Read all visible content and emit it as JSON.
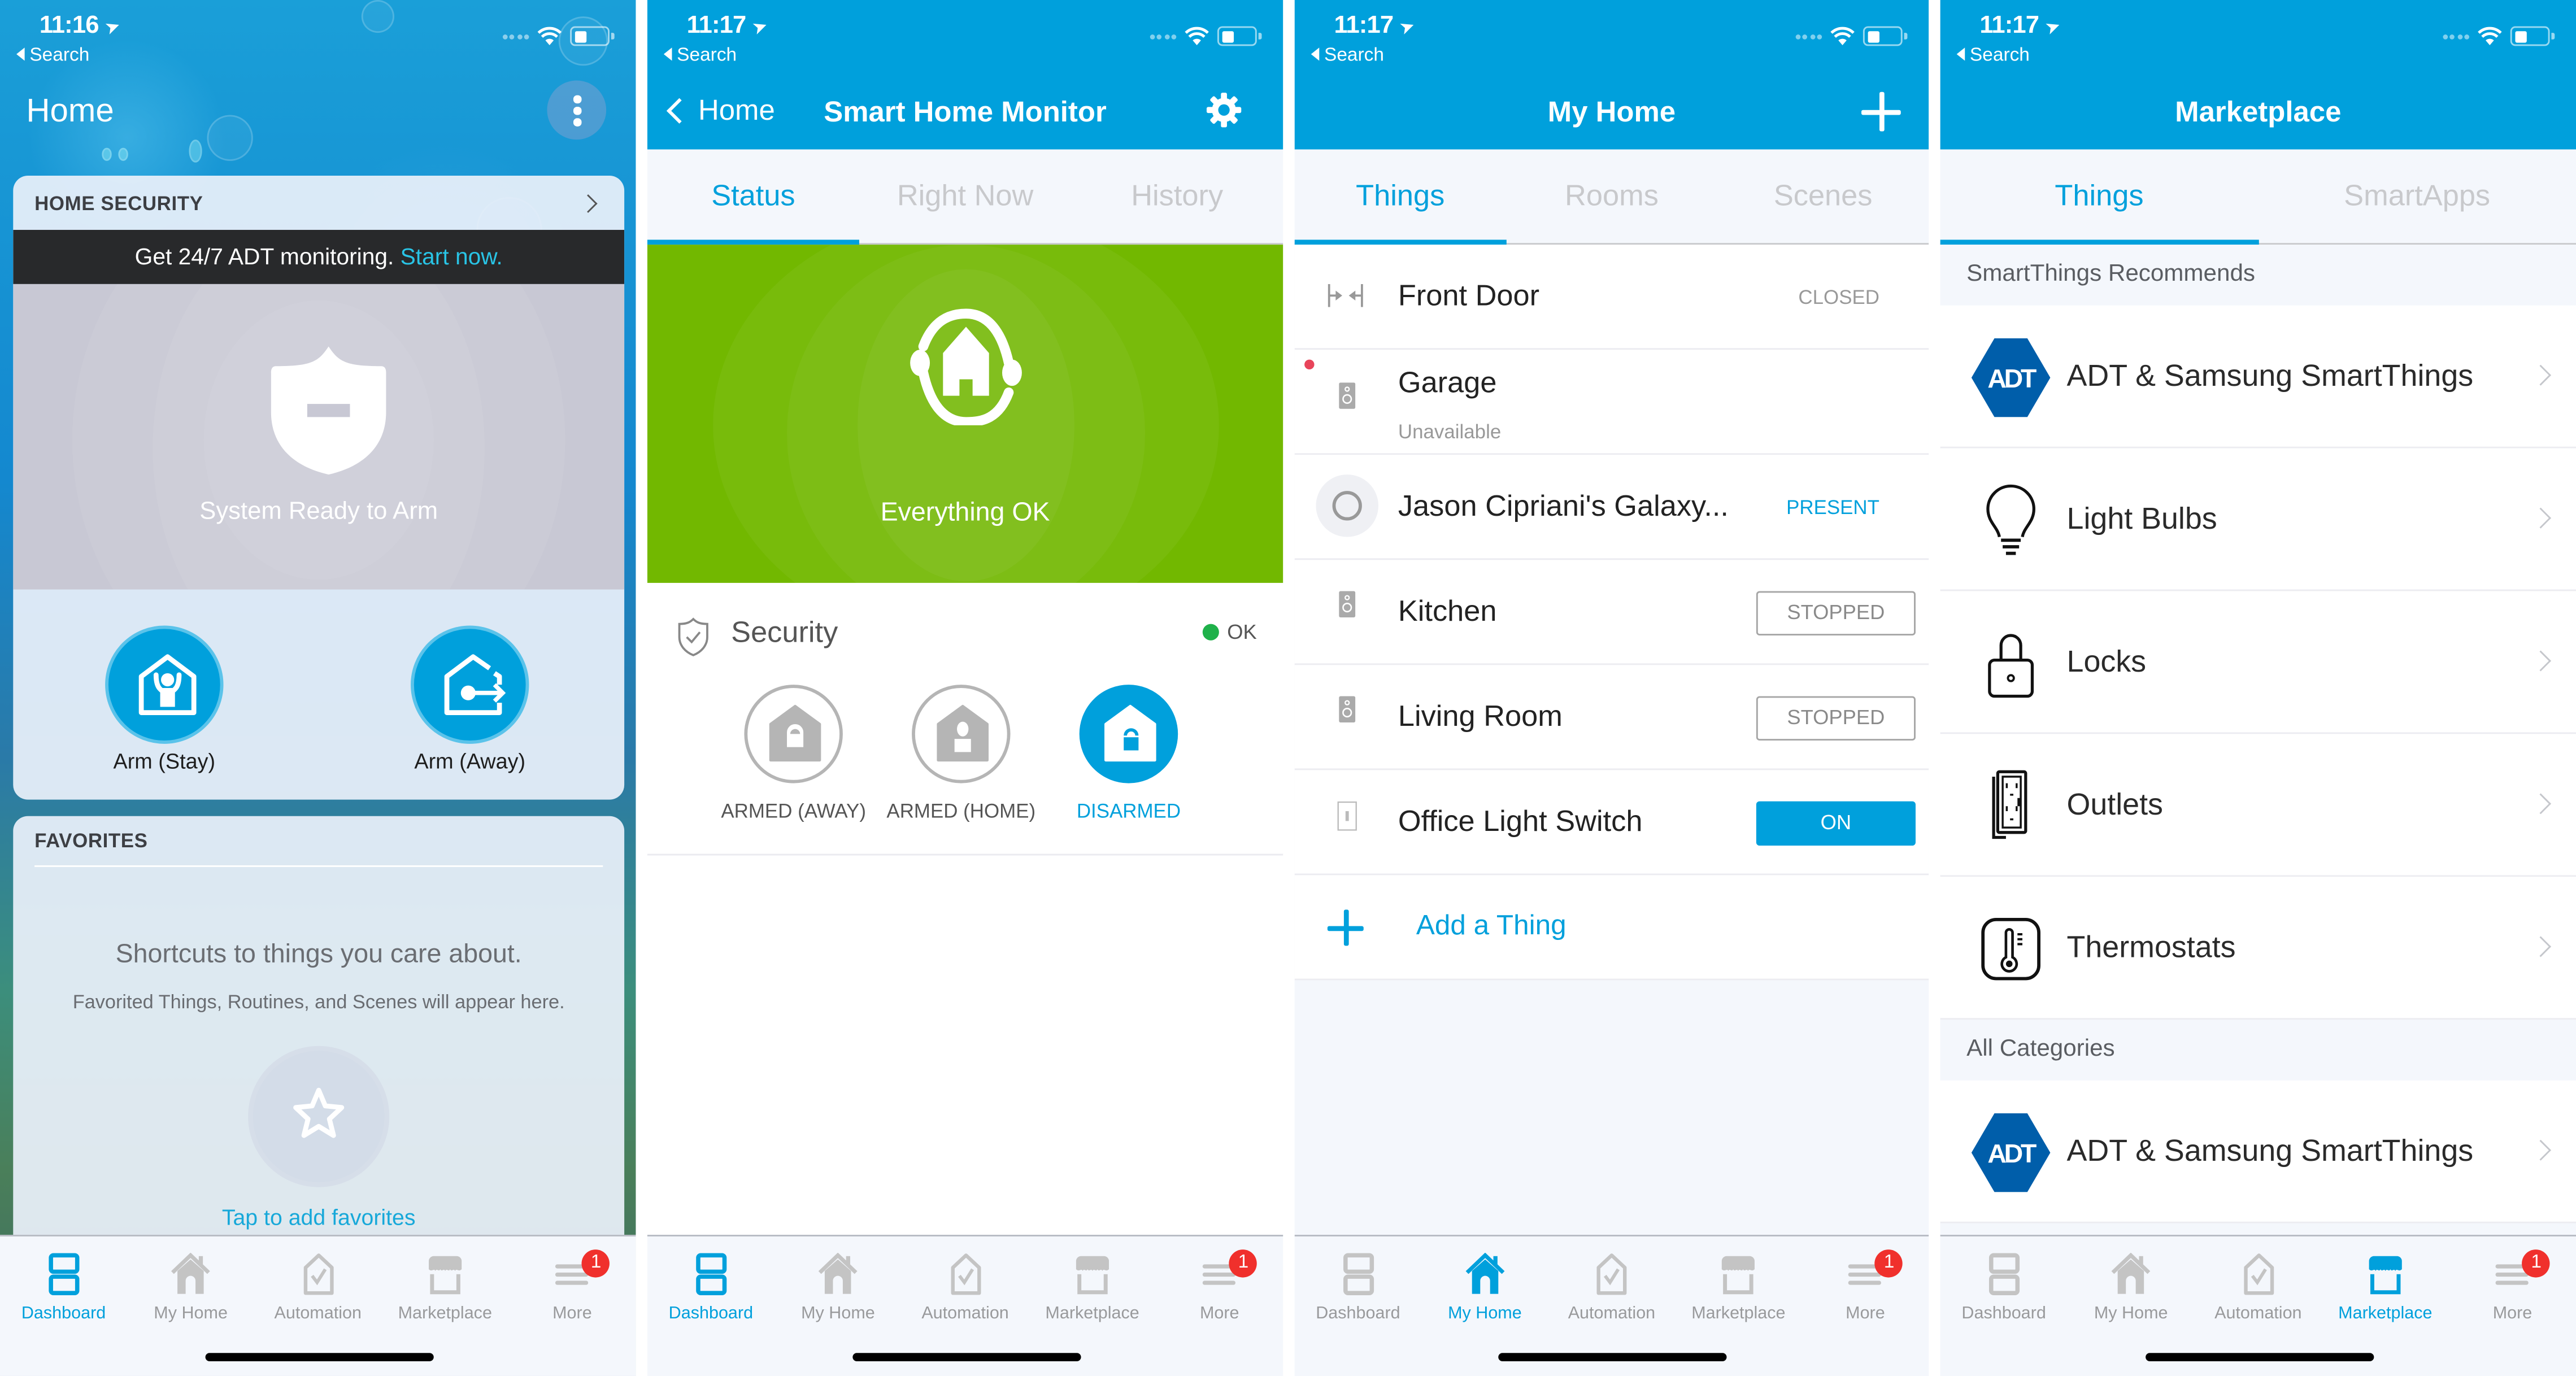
{
  "status_bars": [
    {
      "time": "11:16",
      "back_label": "Search"
    },
    {
      "time": "11:17",
      "back_label": "Search"
    },
    {
      "time": "11:17",
      "back_label": "Search"
    },
    {
      "time": "11:17",
      "back_label": "Search"
    }
  ],
  "tab_bar": {
    "items": [
      {
        "label": "Dashboard",
        "icon": "dashboard-icon"
      },
      {
        "label": "My Home",
        "icon": "home-icon"
      },
      {
        "label": "Automation",
        "icon": "automation-icon"
      },
      {
        "label": "Marketplace",
        "icon": "marketplace-icon"
      },
      {
        "label": "More",
        "icon": "menu-icon",
        "badge": "1"
      }
    ],
    "active_per_screen": [
      "Dashboard",
      "Dashboard",
      "My Home",
      "Marketplace"
    ],
    "active_color": "#00a0dc",
    "inactive_color": "#999a9c",
    "badge_color": "#f0302c"
  },
  "dashboard": {
    "title": "Home",
    "home_security": {
      "header": "HOME SECURITY",
      "banner_text": "Get 24/7 ADT monitoring.",
      "banner_link": "Start now.",
      "status_text": "System Ready to Arm",
      "buttons": [
        {
          "label": "Arm (Stay)",
          "icon": "arm-stay-icon"
        },
        {
          "label": "Arm (Away)",
          "icon": "arm-away-icon"
        }
      ]
    },
    "favorites": {
      "header": "FAVORITES",
      "headline": "Shortcuts to things you care about.",
      "subtext": "Favorited Things, Routines, and Scenes will appear here.",
      "link": "Tap to add favorites"
    }
  },
  "smart_home_monitor": {
    "back_label": "Home",
    "title": "Smart Home Monitor",
    "tabs": [
      {
        "label": "Status",
        "active": true
      },
      {
        "label": "Right Now",
        "active": false
      },
      {
        "label": "History",
        "active": false
      }
    ],
    "status_text": "Everything OK",
    "status_color": "#72b800",
    "security": {
      "title": "Security",
      "state_label": "OK",
      "state_color": "#1fb14a",
      "modes": [
        {
          "label": "ARMED (AWAY)",
          "active": false
        },
        {
          "label": "ARMED (HOME)",
          "active": false
        },
        {
          "label": "DISARMED",
          "active": true
        }
      ]
    }
  },
  "my_home": {
    "title": "My Home",
    "tabs": [
      {
        "label": "Things",
        "active": true
      },
      {
        "label": "Rooms",
        "active": false
      },
      {
        "label": "Scenes",
        "active": false
      }
    ],
    "things": [
      {
        "name": "Front Door",
        "status": "CLOSED",
        "type": "text",
        "icon": "contact-sensor-icon"
      },
      {
        "name": "Garage",
        "sub": "Unavailable",
        "type": "none",
        "icon": "speaker-icon",
        "alert": true
      },
      {
        "name": "Jason Cipriani's Galaxy...",
        "status": "PRESENT",
        "type": "blue-text",
        "icon": "presence-icon"
      },
      {
        "name": "Kitchen",
        "status": "STOPPED",
        "type": "button",
        "icon": "speaker-icon"
      },
      {
        "name": "Living Room",
        "status": "STOPPED",
        "type": "button",
        "icon": "speaker-icon"
      },
      {
        "name": "Office Light Switch",
        "status": "ON",
        "type": "button-on",
        "icon": "light-switch-icon"
      }
    ],
    "add_label": "Add a Thing"
  },
  "marketplace": {
    "title": "Marketplace",
    "tabs": [
      {
        "label": "Things",
        "active": true
      },
      {
        "label": "SmartApps",
        "active": false
      }
    ],
    "recommended_header": "SmartThings Recommends",
    "recommended": [
      {
        "label": "ADT & Samsung SmartThings",
        "icon": "adt-logo-icon"
      },
      {
        "label": "Light Bulbs",
        "icon": "light-bulb-icon"
      },
      {
        "label": "Locks",
        "icon": "lock-icon"
      },
      {
        "label": "Outlets",
        "icon": "outlet-icon"
      },
      {
        "label": "Thermostats",
        "icon": "thermostat-icon"
      }
    ],
    "all_header": "All Categories",
    "all": [
      {
        "label": "ADT & Samsung SmartThings",
        "icon": "adt-logo-icon"
      }
    ],
    "adt_logo_text": "ADT",
    "adt_color": "#005eaa"
  }
}
